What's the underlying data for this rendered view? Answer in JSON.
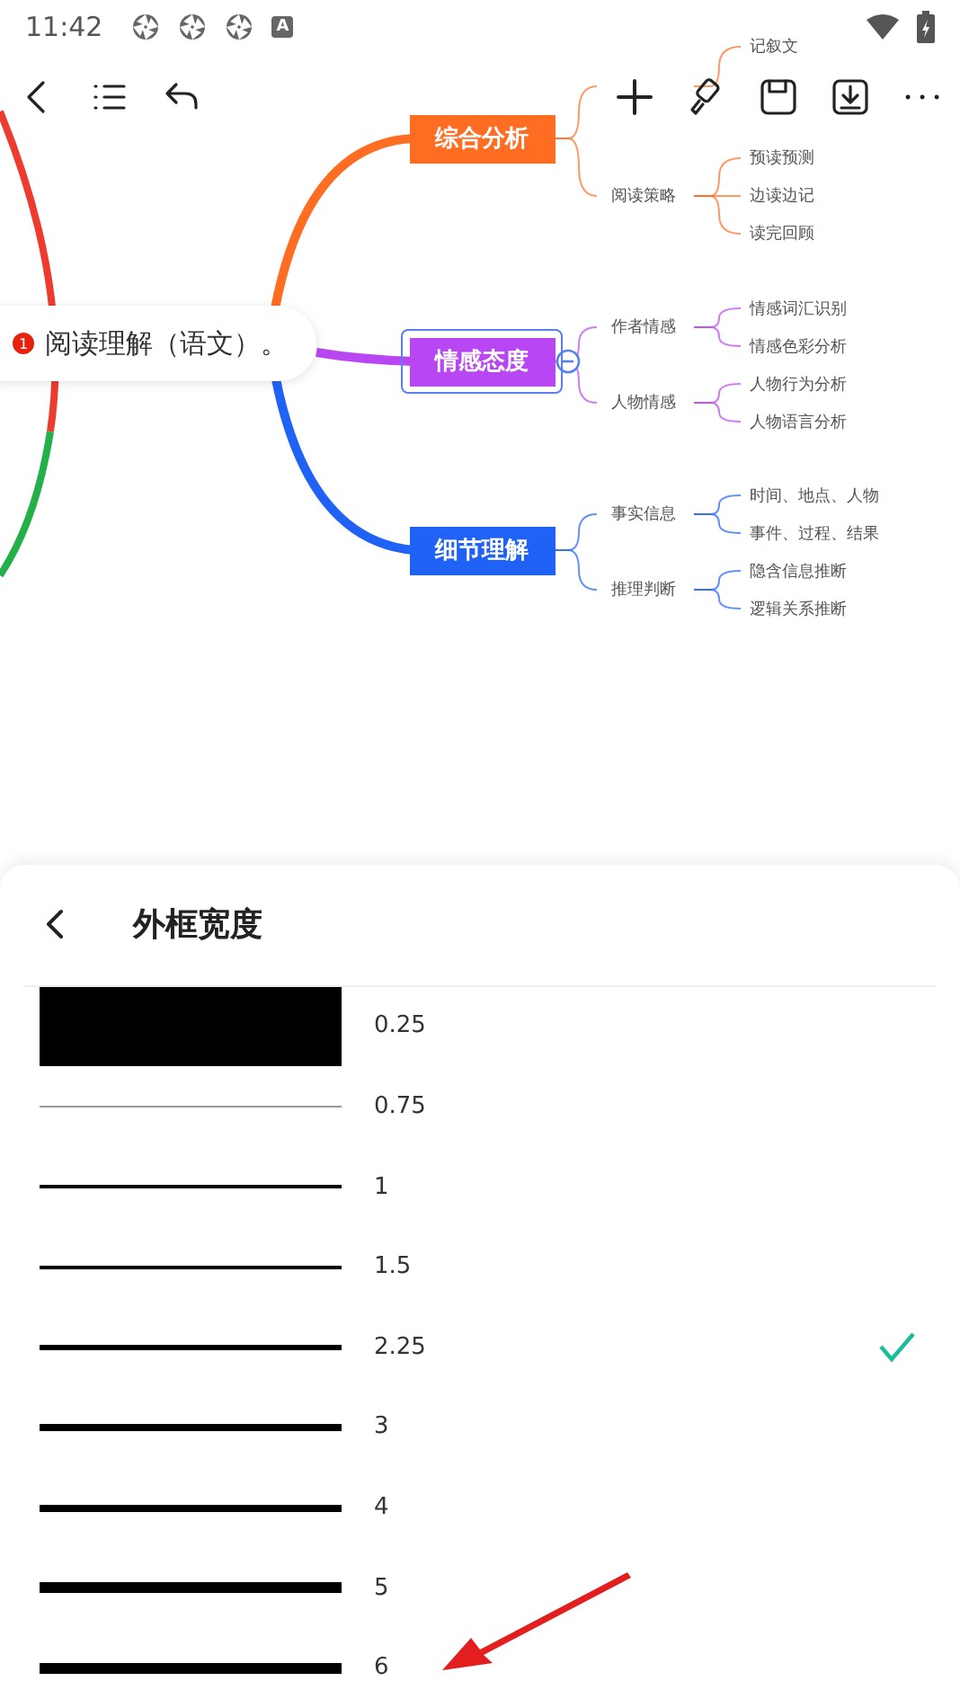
{
  "status_bar": {
    "time": "11:42",
    "badge": "A"
  },
  "mindmap": {
    "root": {
      "badge": "1",
      "text": "阅读理解（语文）。"
    },
    "branches": [
      {
        "text": "综合分析",
        "color": "#ff6d23",
        "selected": false,
        "children": [
          {
            "children": [
              {
                "text": "记叙文"
              }
            ]
          },
          {
            "text": "阅读策略",
            "children": [
              {
                "text": "预读预测"
              },
              {
                "text": "边读边记"
              },
              {
                "text": "读完回顾"
              }
            ]
          }
        ]
      },
      {
        "text": "情感态度",
        "color": "#b846f2",
        "selected": true,
        "children": [
          {
            "text": "作者情感",
            "children": [
              {
                "text": "情感词汇识别"
              },
              {
                "text": "情感色彩分析"
              }
            ]
          },
          {
            "text": "人物情感",
            "children": [
              {
                "text": "人物行为分析"
              },
              {
                "text": "人物语言分析"
              }
            ]
          }
        ]
      },
      {
        "text": "细节理解",
        "color": "#2162f6",
        "selected": false,
        "children": [
          {
            "text": "事实信息",
            "children": [
              {
                "text": "时间、地点、人物"
              },
              {
                "text": "事件、过程、结果"
              }
            ]
          },
          {
            "text": "推理判断",
            "children": [
              {
                "text": "隐含信息推断"
              },
              {
                "text": "逻辑关系推断"
              }
            ]
          }
        ]
      }
    ]
  },
  "sheet": {
    "title": "外框宽度",
    "options": [
      {
        "label": "0.25",
        "kind": "block",
        "selected": false
      },
      {
        "label": "0.75",
        "kind": "hairline",
        "selected": false
      },
      {
        "label": "1",
        "kind": "thin",
        "selected": false
      },
      {
        "label": "1.5",
        "kind": "thin",
        "selected": false
      },
      {
        "label": "2.25",
        "kind": "medium",
        "selected": true
      },
      {
        "label": "3",
        "kind": "bold",
        "selected": false
      },
      {
        "label": "4",
        "kind": "bold",
        "selected": false
      },
      {
        "label": "5",
        "kind": "heavy",
        "selected": false
      },
      {
        "label": "6",
        "kind": "heavy",
        "selected": false
      }
    ]
  }
}
